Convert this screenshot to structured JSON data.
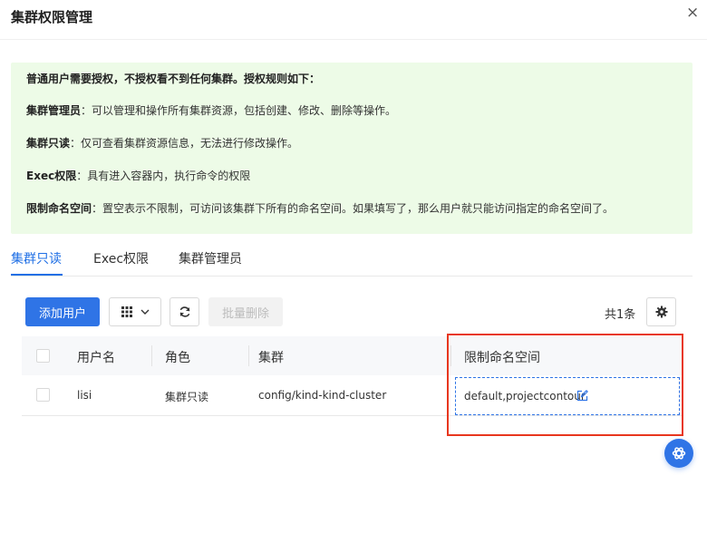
{
  "dialog": {
    "title": "集群权限管理",
    "close_glyph": "×"
  },
  "notice": {
    "intro": "普通用户需要授权，不授权看不到任何集群。授权规则如下：",
    "rules": [
      {
        "term": "集群管理员",
        "desc": "：可以管理和操作所有集群资源，包括创建、修改、删除等操作。"
      },
      {
        "term": "集群只读",
        "desc": "：仅可查看集群资源信息，无法进行修改操作。"
      },
      {
        "term": "Exec权限",
        "desc": "：具有进入容器内，执行命令的权限"
      },
      {
        "term": "限制命名空间",
        "desc": "：置空表示不限制，可访问该集群下所有的命名空间。如果填写了，那么用户就只能访问指定的命名空间了。"
      }
    ],
    "bg_color": "#edfbe7"
  },
  "tabs": [
    {
      "label": "集群只读",
      "active": true
    },
    {
      "label": "Exec权限",
      "active": false
    },
    {
      "label": "集群管理员",
      "active": false
    }
  ],
  "toolbar": {
    "add_label": "添加用户",
    "batch_delete_label": "批量删除",
    "total_text": "共1条"
  },
  "table": {
    "headers": [
      "用户名",
      "角色",
      "集群",
      "限制命名空间"
    ],
    "rows": [
      {
        "username": "lisi",
        "role": "集群只读",
        "cluster": "config/kind-kind-cluster",
        "namespace": "default,projectcontour"
      }
    ]
  },
  "icons": {
    "close": "close-icon",
    "grid": "grid-icon",
    "chevron": "chevron-down-icon",
    "refresh": "refresh-icon",
    "gear": "gear-icon",
    "edit": "edit-icon",
    "assistant": "assistant-icon"
  },
  "colors": {
    "accent": "#2f74e6",
    "highlight": "#e8371f"
  }
}
